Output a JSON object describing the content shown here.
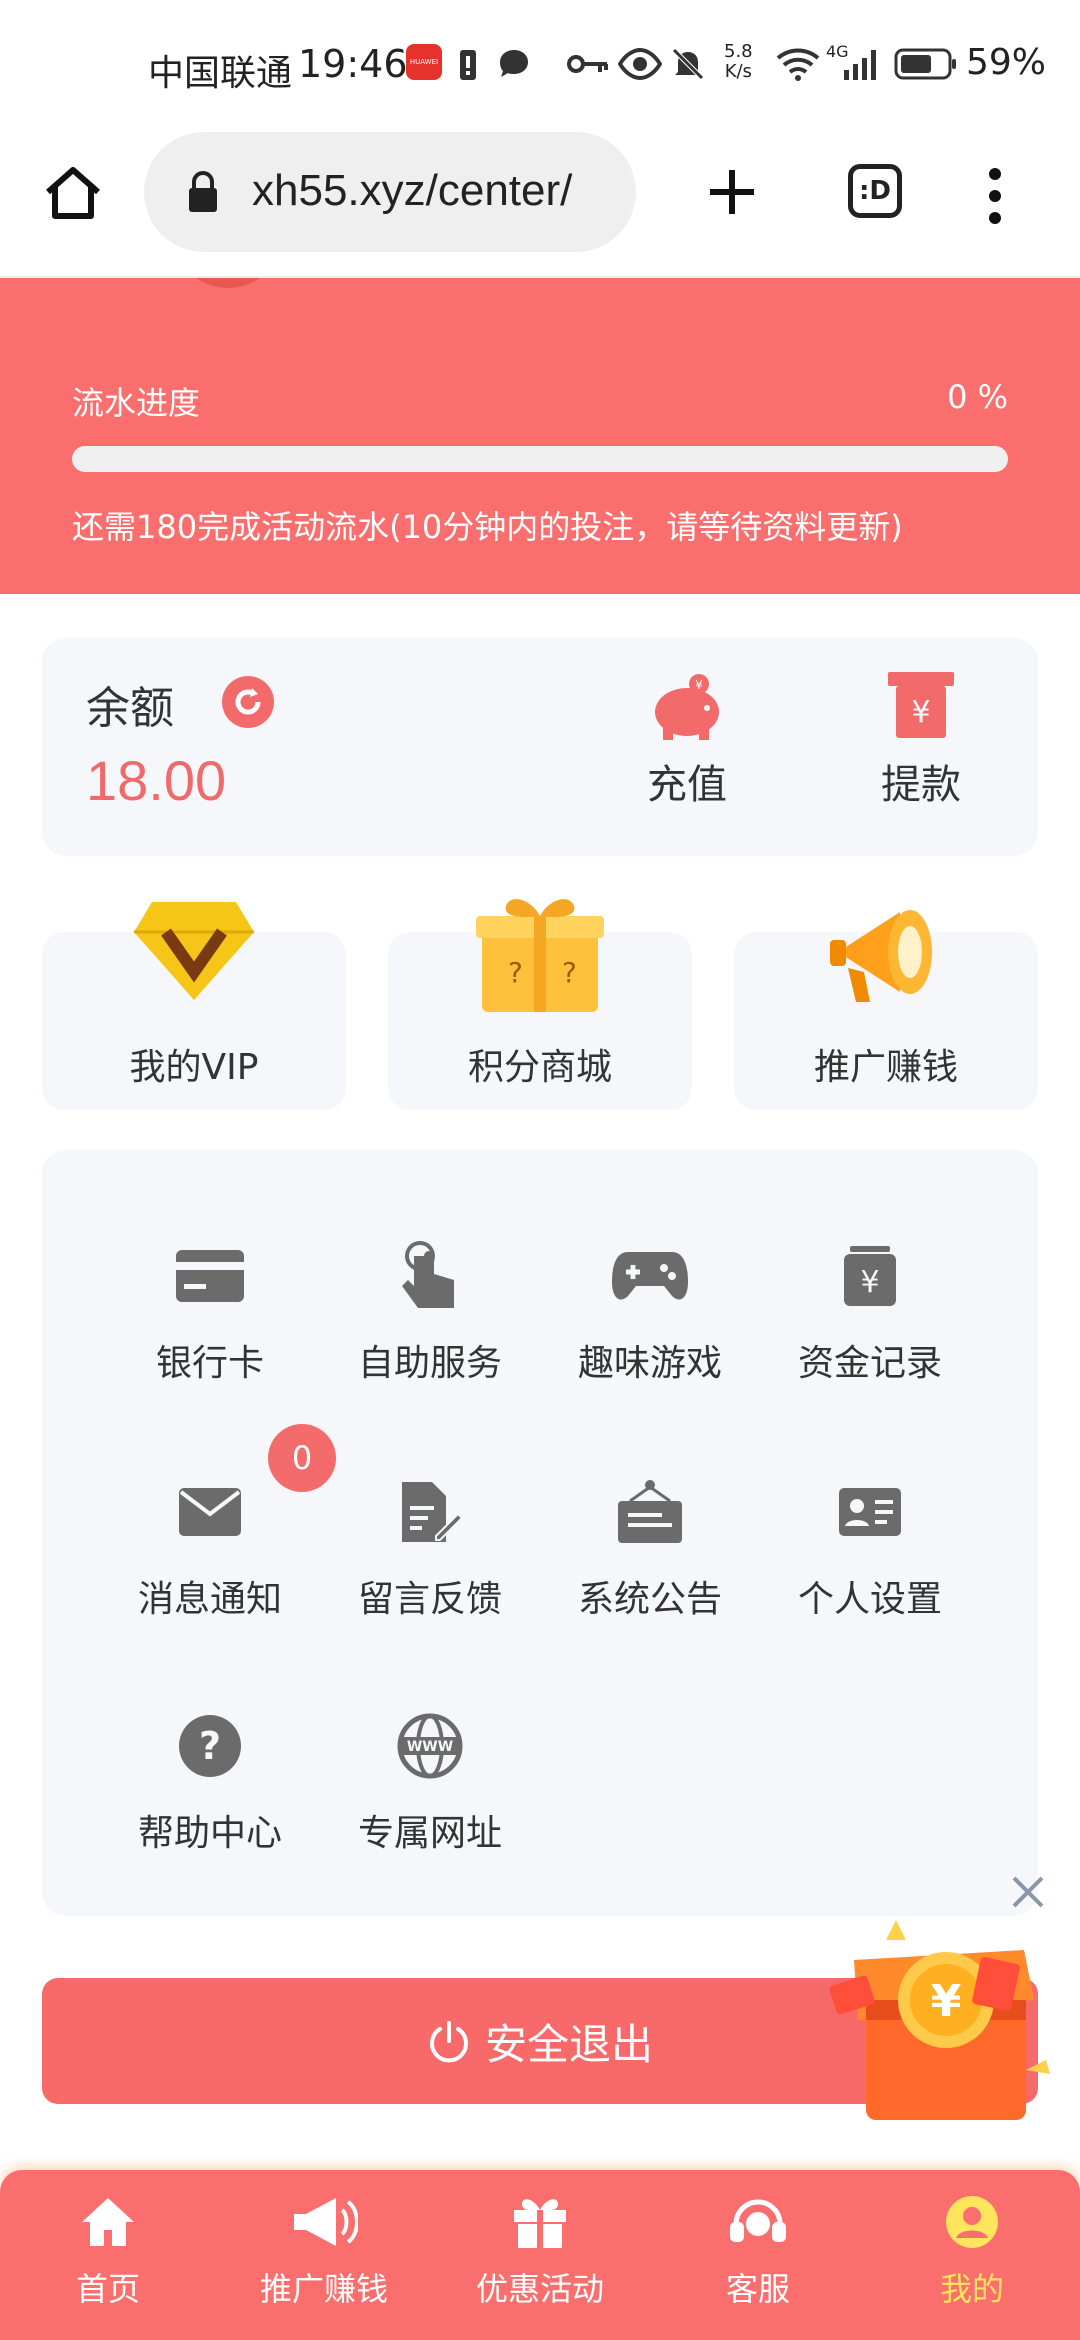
{
  "status_bar": {
    "carrier": "中国联通",
    "time": "19:46",
    "app_badge": "HUAWEI",
    "net_speed_value": "5.8",
    "net_speed_unit": "K/s",
    "network": "4G",
    "battery": "59%"
  },
  "browser": {
    "url": "xh55.xyz/center/",
    "tabs_label": ":D"
  },
  "header": {
    "turnover_label": "流水进度",
    "turnover_percent": "0 %",
    "turnover_progress": 0,
    "turnover_note": "还需180完成活动流水(10分钟内的投注，请等待资料更新)"
  },
  "balance": {
    "label": "余额",
    "value": "18.00",
    "recharge_label": "充值",
    "withdraw_label": "提款"
  },
  "tiles": {
    "vip": "我的VIP",
    "mall": "积分商城",
    "promo": "推广赚钱"
  },
  "grid": {
    "bank_card": "银行卡",
    "self_service": "自助服务",
    "fun_games": "趣味游戏",
    "fund_records": "资金记录",
    "messages": "消息通知",
    "messages_badge": "0",
    "feedback": "留言反馈",
    "announcements": "系统公告",
    "settings": "个人设置",
    "help": "帮助中心",
    "exclusive_url": "专属网址"
  },
  "logout_label": "安全退出",
  "bottom_nav": {
    "home": "首页",
    "promo": "推广赚钱",
    "offers": "优惠活动",
    "service": "客服",
    "mine": "我的"
  },
  "colors": {
    "brand_red": "#fb6e6e",
    "balance_red": "#f06a6a",
    "active_nav": "#ffe45c",
    "card_bg": "#f6f7fb",
    "icon_gray": "#6b6b6b"
  }
}
